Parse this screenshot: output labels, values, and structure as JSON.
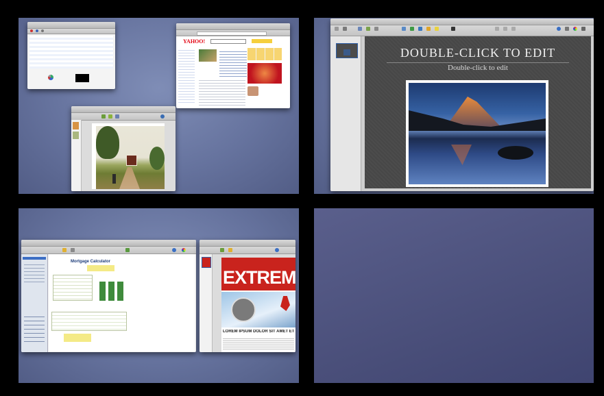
{
  "spaces": [
    {
      "name": "space-1"
    },
    {
      "name": "space-2"
    },
    {
      "name": "space-3"
    },
    {
      "name": "space-4"
    }
  ],
  "yahoo": {
    "logo": "YAHOO!"
  },
  "keynote": {
    "slide_title": "DOUBLE-CLICK TO EDIT",
    "slide_subtitle": "Double-click to edit"
  },
  "numbers": {
    "sheet_title": "Mortgage Calculator"
  },
  "pages": {
    "headline": "EXTREME",
    "subheadline": "LOREM IPSUM DOLOR SIT AMET ETIAM"
  },
  "colors": {
    "desktop": "#6a77a2",
    "keynote_bg": "#4b4b4b",
    "extreme_red": "#c9231d",
    "numbers_green": "#3f8b3c"
  }
}
